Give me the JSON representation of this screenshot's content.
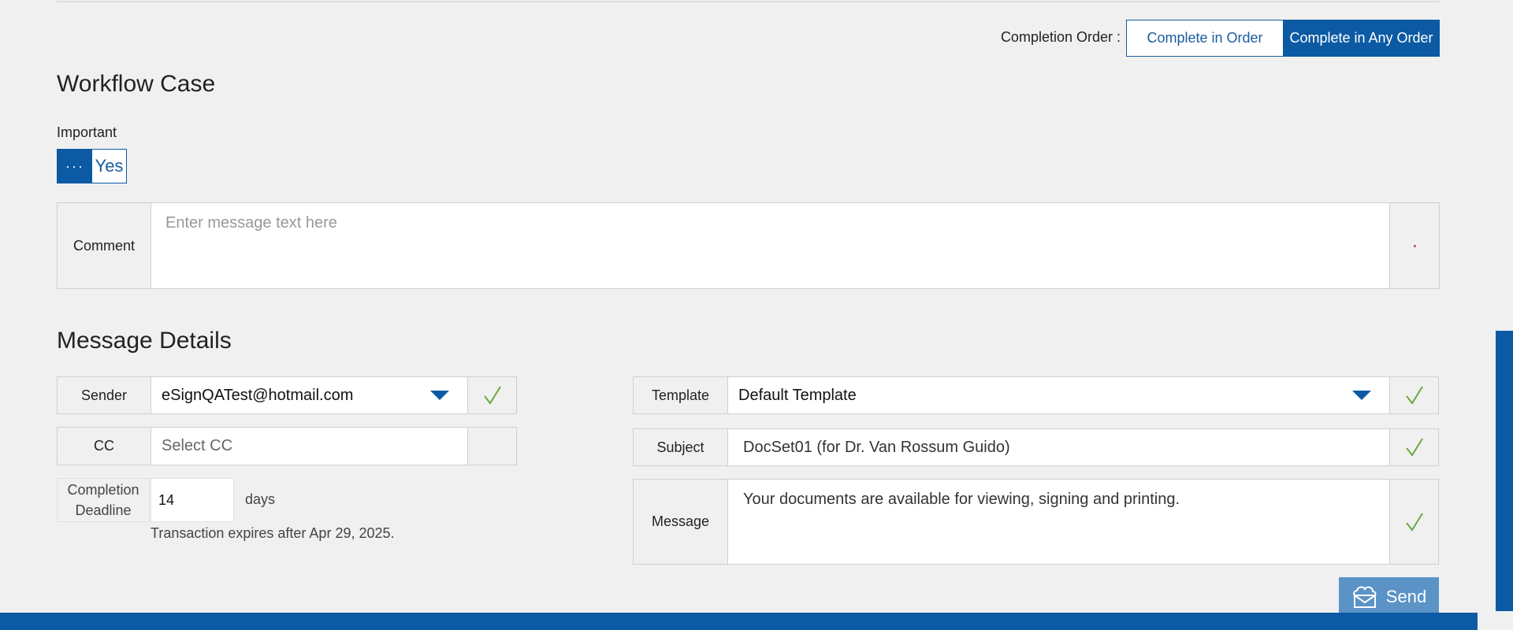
{
  "completion_order": {
    "label": "Completion Order :",
    "options": [
      "Complete in Order",
      "Complete in Any Order"
    ],
    "selected": "Complete in Any Order"
  },
  "workflow_case": {
    "title": "Workflow Case",
    "important_label": "Important",
    "toggle_off": "···",
    "toggle_on": "Yes",
    "comment_label": "Comment",
    "comment_placeholder": "Enter message text here",
    "comment_value": ""
  },
  "message_details": {
    "title": "Message Details",
    "sender_label": "Sender",
    "sender_value": "eSignQATest@hotmail.com",
    "cc_label": "CC",
    "cc_placeholder": "Select CC",
    "deadline_label": "Completion Deadline",
    "deadline_value": "14",
    "deadline_unit": "days",
    "expires_text": "Transaction expires after Apr 29, 2025.",
    "template_label": "Template",
    "template_value": "Default Template",
    "subject_label": "Subject",
    "subject_value": "DocSet01 (for Dr. Van Rossum Guido)",
    "message_label": "Message",
    "message_value": "Your documents are available for viewing, signing and printing."
  },
  "send": {
    "label": "Send"
  },
  "colors": {
    "primary": "#0b5aa3",
    "send_button": "#5b93c7",
    "check_green": "#6aa842",
    "background": "#f0f0f0"
  },
  "icons": {
    "check": "check-icon",
    "dropdown": "chevron-down-icon",
    "send": "envelope-cloud-icon"
  }
}
